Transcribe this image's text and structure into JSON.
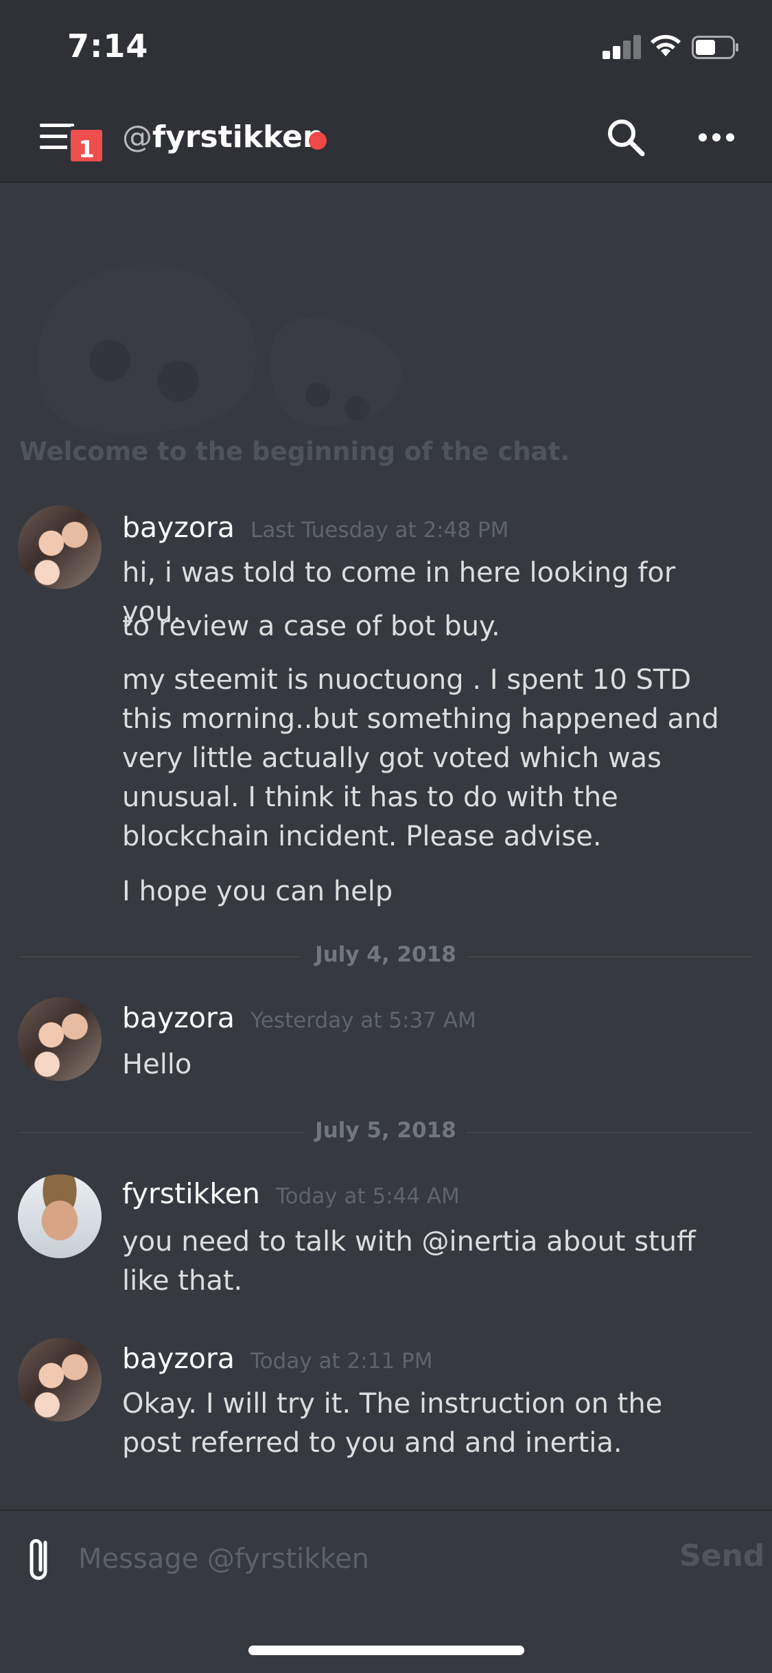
{
  "status_bar": {
    "time": "7:14"
  },
  "header": {
    "badge_count": "1",
    "at_symbol": "@",
    "channel_name": "fyrstikken",
    "status_color": "#f04747"
  },
  "welcome": {
    "text": "Welcome to the beginning of the chat."
  },
  "messages": [
    {
      "author": "bayzora",
      "time": "Last Tuesday at 2:48 PM",
      "lines": [
        "hi, i was told to come in here looking for you.",
        "to review a case of bot buy.",
        "my steemit is nuoctuong . I spent 10 STD this morning..but something happened and very little actually got voted which was unusual. I think it has to do with the blockchain incident. Please advise.",
        "I hope you can help"
      ]
    },
    {
      "author": "bayzora",
      "time": "Yesterday at 5:37 AM",
      "lines": [
        "Hello"
      ]
    },
    {
      "author": "fyrstikken",
      "time": "Today at 5:44 AM",
      "lines": [
        "you need to talk with @inertia about stuff like that."
      ]
    },
    {
      "author": "bayzora",
      "time": "Today at 2:11 PM",
      "lines": [
        "Okay. I will try it. The instruction on the post referred to you and and inertia."
      ]
    }
  ],
  "dividers": [
    "July 4, 2018",
    "July 5, 2018"
  ],
  "composer": {
    "placeholder": "Message @fyrstikken",
    "send_label": "Send"
  },
  "colors": {
    "background": "#36393f",
    "header": "#2f3136",
    "badge": "#ef4e4f"
  }
}
